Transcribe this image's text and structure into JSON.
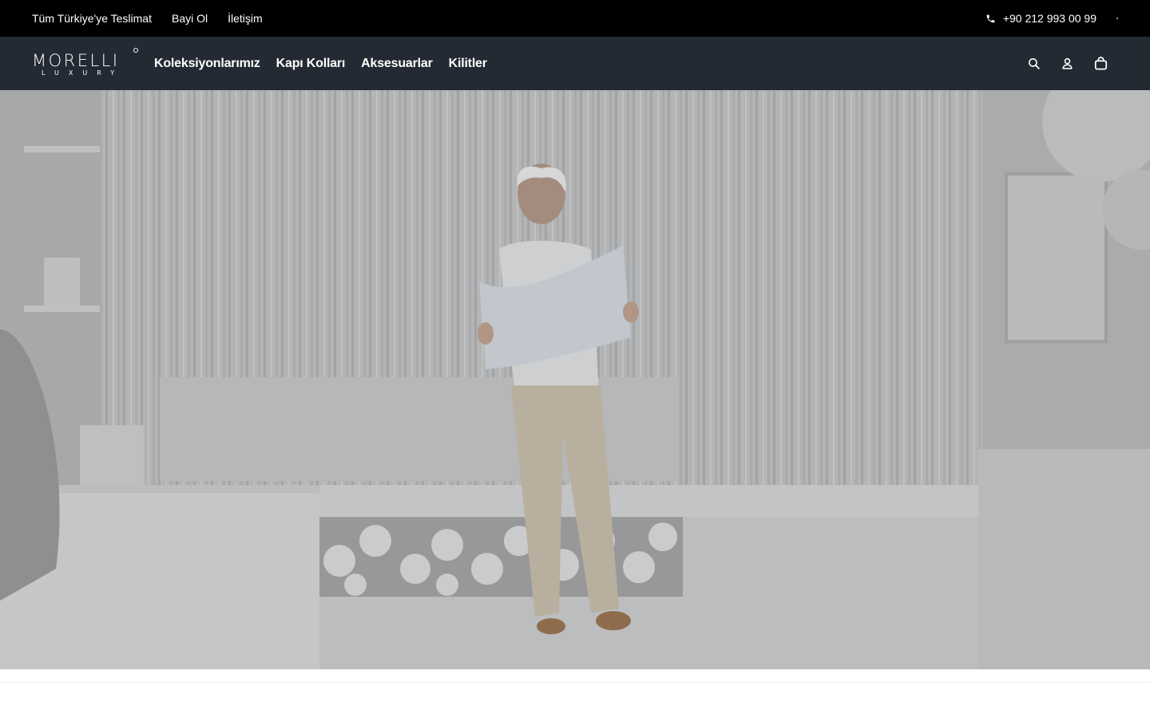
{
  "topbar": {
    "links": [
      "Tüm Türkiye'ye Teslimat",
      "Bayi Ol",
      "İletişim"
    ],
    "phone": "+90 212 993 00 99",
    "phone_icon": "phone-icon"
  },
  "header": {
    "logo_text": "MORELLI",
    "logo_subtext": "LUXURY",
    "menu": [
      "Koleksiyonlarımız",
      "Kapı Kolları",
      "Aksesuarlar",
      "Kilitler"
    ],
    "icons": [
      "search-icon",
      "account-icon",
      "cart-icon"
    ]
  },
  "hero": {
    "image": "man-reading-blueprint-in-white-room",
    "colors": {
      "wall": "#c6c6c6",
      "floor": "#d2d2d2",
      "overlay": "#232a33"
    }
  },
  "colors": {
    "topbar_bg": "#000000",
    "navbar_bg": "#232a33",
    "text": "#ffffff"
  }
}
